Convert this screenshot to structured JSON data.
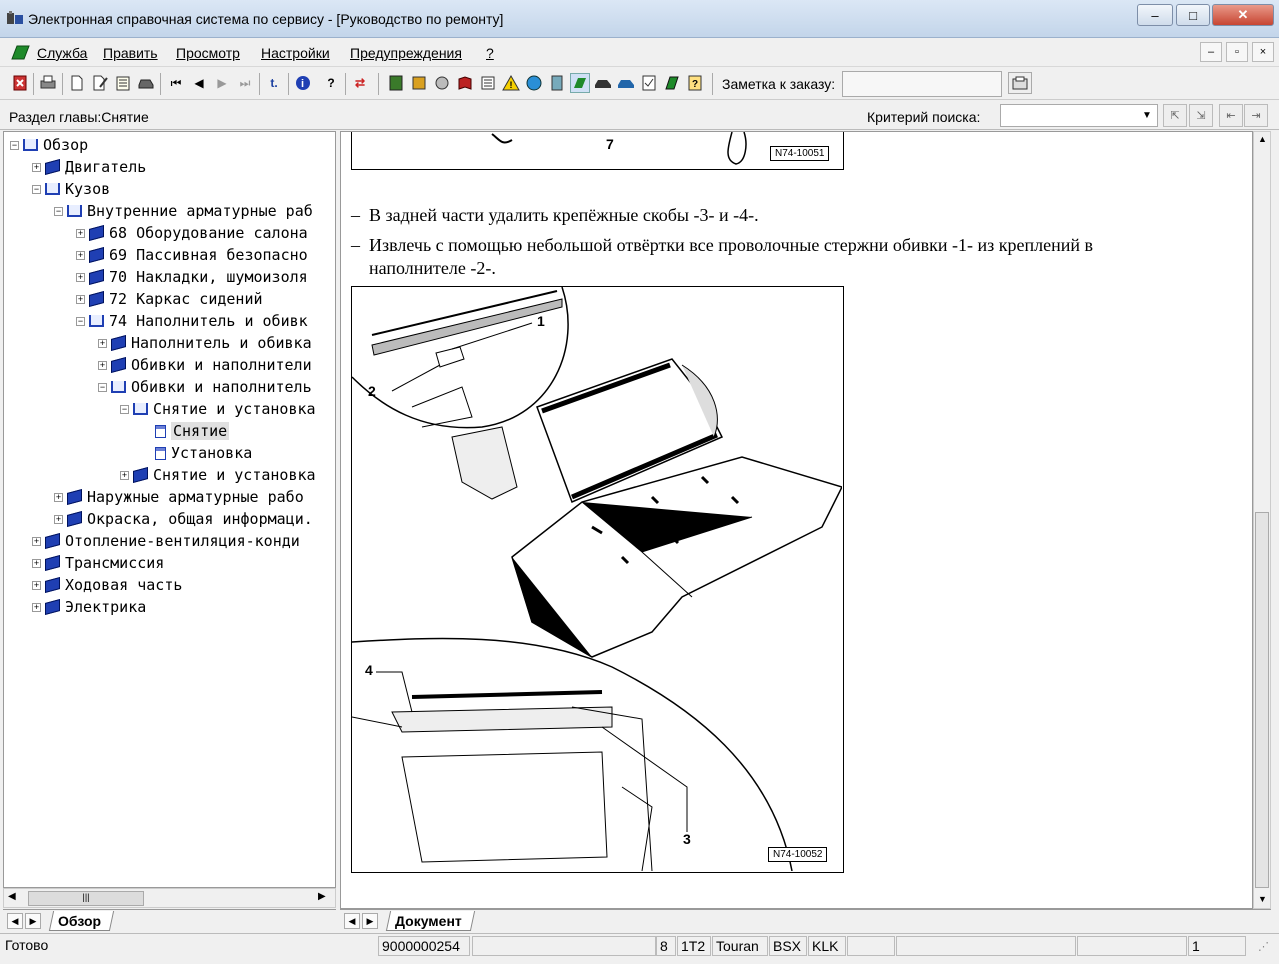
{
  "window": {
    "title": "Электронная справочная система по сервису - [Руководство по ремонту]",
    "minimize": "–",
    "maximize": "□",
    "close": "✕"
  },
  "menu": {
    "items": [
      "Служба",
      "Править",
      "Просмотр",
      "Настройки",
      "Предупреждения",
      "?"
    ],
    "mdi_min": "–",
    "mdi_restore": "▫",
    "mdi_close": "×"
  },
  "toolbar": {
    "note_label": "Заметка к заказу:"
  },
  "infobar": {
    "section_label": "Раздел главы:Снятие",
    "search_label": "Критерий  поиска:",
    "search_value": ""
  },
  "tree": {
    "nodes": [
      {
        "label": "Обзор",
        "depth": 0,
        "sign": "-",
        "icon": "open"
      },
      {
        "label": "Двигатель",
        "depth": 1,
        "sign": "+",
        "icon": "closed"
      },
      {
        "label": "Кузов",
        "depth": 1,
        "sign": "-",
        "icon": "open"
      },
      {
        "label": "Внутренние арматурные раб",
        "depth": 2,
        "sign": "-",
        "icon": "open"
      },
      {
        "label": "68 Оборудование салона",
        "depth": 3,
        "sign": "+",
        "icon": "closed"
      },
      {
        "label": "69 Пассивная безопасно",
        "depth": 3,
        "sign": "+",
        "icon": "closed"
      },
      {
        "label": "70 Накладки, шумоизоля",
        "depth": 3,
        "sign": "+",
        "icon": "closed"
      },
      {
        "label": "72 Каркас сидений",
        "depth": 3,
        "sign": "+",
        "icon": "closed"
      },
      {
        "label": "74 Наполнитель и обивк",
        "depth": 3,
        "sign": "-",
        "icon": "open"
      },
      {
        "label": "Наполнитель и обивка",
        "depth": 4,
        "sign": "+",
        "icon": "closed"
      },
      {
        "label": "Обивки и наполнители",
        "depth": 4,
        "sign": "+",
        "icon": "closed"
      },
      {
        "label": "Обивки и наполнитель",
        "depth": 4,
        "sign": "-",
        "icon": "open"
      },
      {
        "label": "Снятие и установка",
        "depth": 5,
        "sign": "-",
        "icon": "open"
      },
      {
        "label": "Снятие",
        "depth": 6,
        "sign": "",
        "icon": "page",
        "selected": true
      },
      {
        "label": "Установка",
        "depth": 6,
        "sign": "",
        "icon": "page"
      },
      {
        "label": "Снятие и установка",
        "depth": 5,
        "sign": "+",
        "icon": "closed"
      },
      {
        "label": "Наружные арматурные рабо",
        "depth": 2,
        "sign": "+",
        "icon": "closed"
      },
      {
        "label": "Окраска, общая информаци.",
        "depth": 2,
        "sign": "+",
        "icon": "closed"
      },
      {
        "label": "Отопление-вентиляция-конди",
        "depth": 1,
        "sign": "+",
        "icon": "closed"
      },
      {
        "label": "Трансмиссия",
        "depth": 1,
        "sign": "+",
        "icon": "closed"
      },
      {
        "label": "Ходовая часть",
        "depth": 1,
        "sign": "+",
        "icon": "closed"
      },
      {
        "label": "Электрика",
        "depth": 1,
        "sign": "+",
        "icon": "closed"
      }
    ],
    "tab_label": "Обзор"
  },
  "document": {
    "fig_top_number": "7",
    "fig_top_code": "N74-10051",
    "step1": "В задней части удалить крепёжные скобы -3- и -4-.",
    "step2_line1": "Извлечь с помощью небольшой отвёртки все проволочные стержни обивки -1- из креплений в",
    "step2_line2": "наполнителе -2-.",
    "dash": "–",
    "fig_labels": [
      "1",
      "2",
      "3",
      "4"
    ],
    "fig_code": "N74-10052",
    "tab_label": "Документ"
  },
  "status": {
    "ready": "Готово",
    "order": "9000000254",
    "fields": [
      "8",
      "1T2",
      "Touran",
      "BSX",
      "KLK"
    ],
    "page": "1"
  }
}
